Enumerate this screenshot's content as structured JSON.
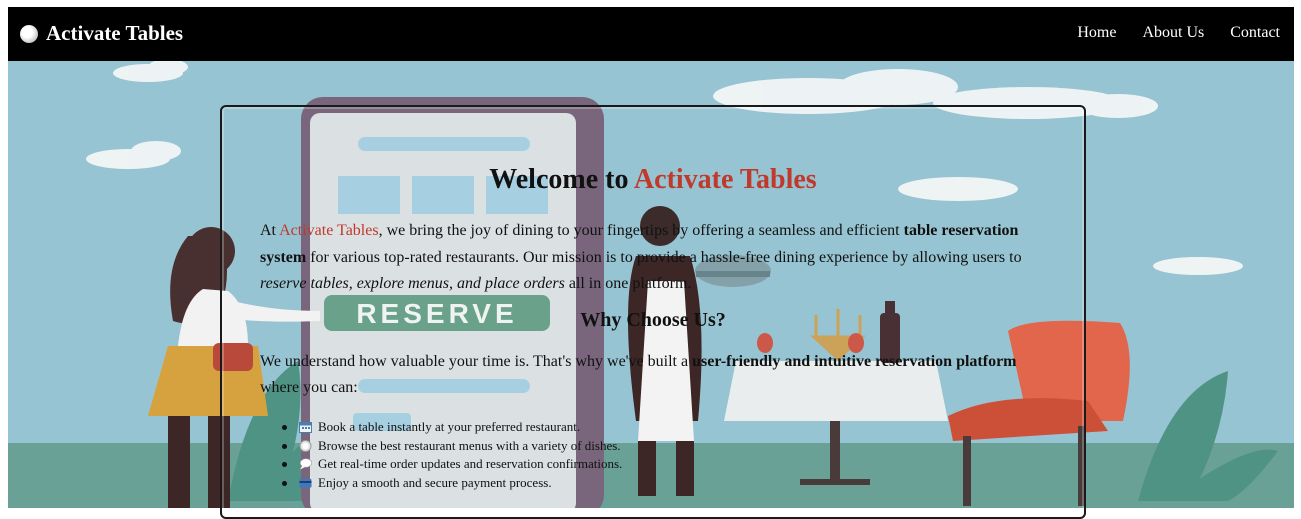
{
  "navbar": {
    "brand_icon": "plate-icon",
    "brand": "Activate Tables",
    "links": [
      "Home",
      "About Us",
      "Contact"
    ]
  },
  "hero": {
    "background_color": "#8fbfcf",
    "phone_screen_button": "RESERVE"
  },
  "welcome": {
    "title_prefix": "Welcome to ",
    "title_accent": "Activate Tables",
    "accent_color": "#c0392b",
    "intro": {
      "before": "At ",
      "brand": "Activate Tables",
      "middle": ", we bring the joy of dining to your fingertips by offering a seamless and efficient ",
      "bold": "table reservation system",
      "after": " for various top-rated restaurants. Our mission is to provide a hassle-free dining experience by allowing users to ",
      "italic": "reserve tables, explore menus, and place orders",
      "end": " all in one platform."
    }
  },
  "why": {
    "title": "Why Choose Us?",
    "desc": {
      "before": "We understand how valuable your time is. That's why we've built a ",
      "bold": "user-friendly and intuitive reservation platform",
      "after": " where you can:"
    },
    "features": [
      {
        "icon": "calendar-icon",
        "text": "Book a table instantly at your preferred restaurant."
      },
      {
        "icon": "plate-icon",
        "text": "Browse the best restaurant menus with a variety of dishes."
      },
      {
        "icon": "chat-bubble-icon",
        "text": "Get real-time order updates and reservation confirmations."
      },
      {
        "icon": "credit-card-icon",
        "text": "Enjoy a smooth and secure payment process."
      }
    ]
  }
}
